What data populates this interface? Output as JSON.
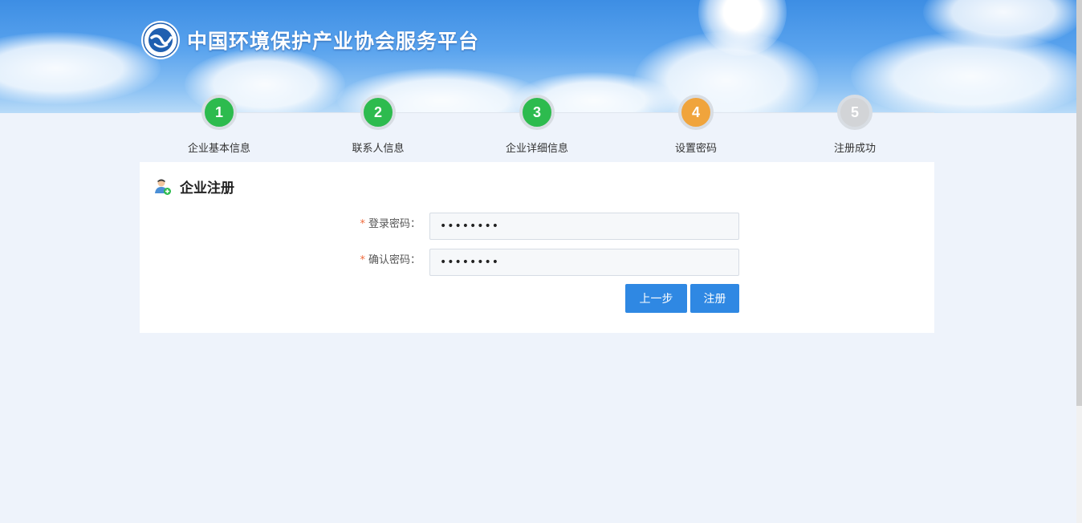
{
  "header": {
    "site_title": "中国环境保护产业协会服务平台",
    "logo_name": "caepi-logo"
  },
  "steps": [
    {
      "number": "1",
      "label": "企业基本信息",
      "status": "done"
    },
    {
      "number": "2",
      "label": "联系人信息",
      "status": "done"
    },
    {
      "number": "3",
      "label": "企业详细信息",
      "status": "done"
    },
    {
      "number": "4",
      "label": "设置密码",
      "status": "current"
    },
    {
      "number": "5",
      "label": "注册成功",
      "status": "todo"
    }
  ],
  "card": {
    "title": "企业注册",
    "icon": "user-add-icon"
  },
  "form": {
    "required_mark": "*",
    "password_label": "登录密码：",
    "password_value": "12345678",
    "confirm_label": "确认密码：",
    "confirm_value": "12345678"
  },
  "buttons": {
    "prev_label": "上一步",
    "register_label": "注册"
  },
  "colors": {
    "step_done": "#2dbb4e",
    "step_current": "#f0a43c",
    "step_todo": "#d2d4d7",
    "primary_button": "#2f88e3",
    "required_star": "#f06a3c"
  }
}
